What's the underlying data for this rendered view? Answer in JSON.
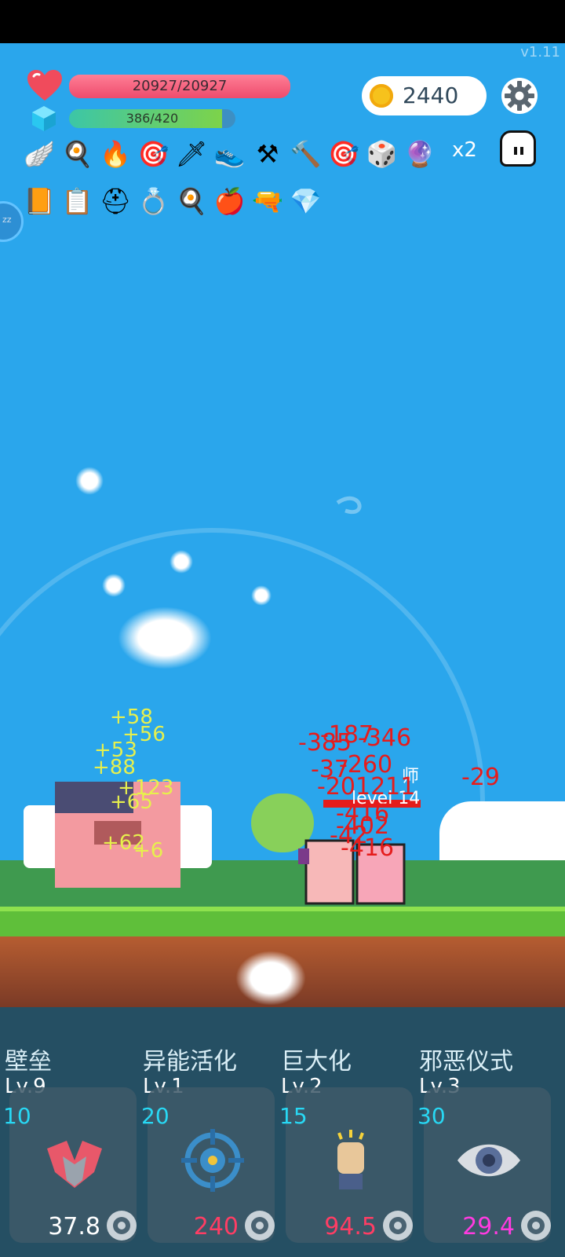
{
  "version": "v1.11",
  "player": {
    "hp": "20927/20927",
    "mp": "386/420",
    "mp_fraction": 0.919
  },
  "coins": "2440",
  "item_multiplier": "x2",
  "items_row1": [
    "wing-icon",
    "fried-egg-icon",
    "torch-icon",
    "target-icon",
    "sword-icon",
    "sneaker-icon",
    "sickle-icon",
    "hammer-icon",
    "target-icon",
    "dice-icon",
    "crystal-ball-icon"
  ],
  "items_row2": [
    "book-icon",
    "notebook-icon",
    "helmet-icon",
    "ring-icon",
    "fried-egg-icon",
    "apple-icon",
    "uzi-icon",
    "diamond-icon"
  ],
  "battle": {
    "enemy_name": "师",
    "enemy_level": "level 14",
    "damage": [
      "-187",
      "-346",
      "-385",
      "-260",
      "-37",
      "-201211",
      "-29",
      "-416",
      "-402",
      "-416",
      "-42"
    ],
    "heals": [
      "+58",
      "+56",
      "+53",
      "+65",
      "+62",
      "+123",
      "+88",
      "+6"
    ]
  },
  "skills": [
    {
      "name": "壁垒",
      "level": "Lv.9",
      "cost": "10",
      "value": "37.8",
      "value_color": "#ffffff",
      "icon": "shield-wing-icon"
    },
    {
      "name": "异能活化",
      "level": "Lv.1",
      "cost": "20",
      "value": "240",
      "value_color": "#ff3d64",
      "icon": "target-icon"
    },
    {
      "name": "巨大化",
      "level": "Lv.2",
      "cost": "15",
      "value": "94.5",
      "value_color": "#ff3d64",
      "icon": "fist-icon"
    },
    {
      "name": "邪恶仪式",
      "level": "Lv.3",
      "cost": "30",
      "value": "29.4",
      "value_color": "#ff3be0",
      "icon": "eye-icon"
    }
  ]
}
